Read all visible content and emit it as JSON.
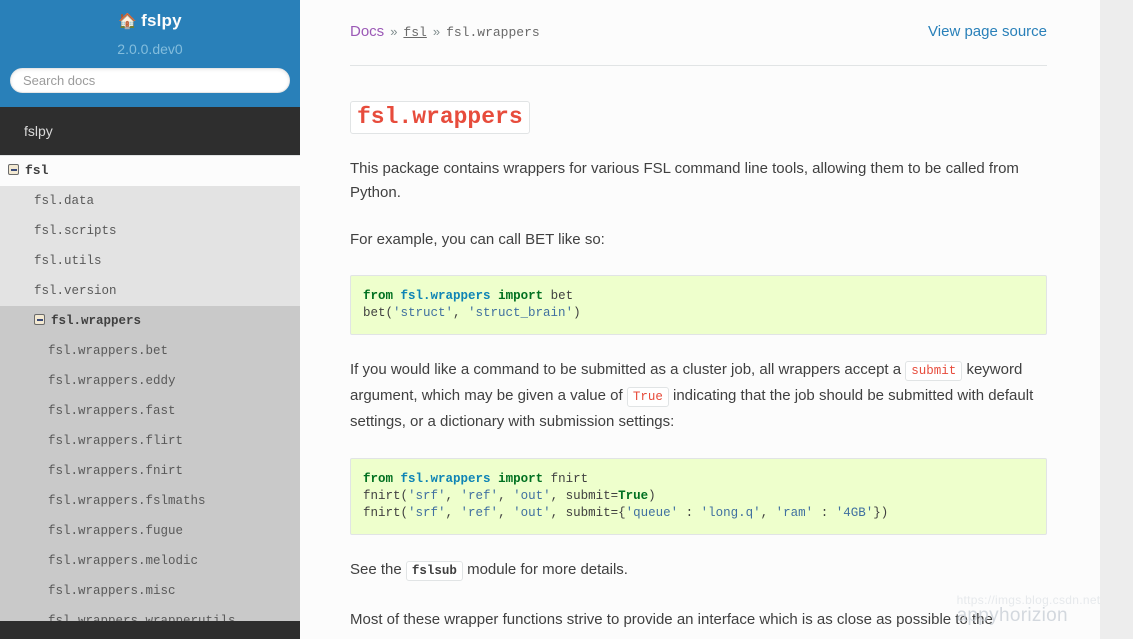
{
  "sidebar": {
    "brand": "fslpy",
    "home_icon": "home-icon",
    "version": "2.0.0.dev0",
    "search_placeholder": "Search docs",
    "search_value": "",
    "nav_title": "fslpy",
    "nav": [
      {
        "label": "fsl",
        "expander": "collapse-icon",
        "current": false,
        "children": [
          {
            "label": "fsl.data"
          },
          {
            "label": "fsl.scripts"
          },
          {
            "label": "fsl.utils"
          },
          {
            "label": "fsl.version"
          },
          {
            "label": "fsl.wrappers",
            "expander": "collapse-icon",
            "current": true,
            "children": [
              {
                "label": "fsl.wrappers.bet"
              },
              {
                "label": "fsl.wrappers.eddy"
              },
              {
                "label": "fsl.wrappers.fast"
              },
              {
                "label": "fsl.wrappers.flirt"
              },
              {
                "label": "fsl.wrappers.fnirt"
              },
              {
                "label": "fsl.wrappers.fslmaths"
              },
              {
                "label": "fsl.wrappers.fugue"
              },
              {
                "label": "fsl.wrappers.melodic"
              },
              {
                "label": "fsl.wrappers.misc"
              },
              {
                "label": "fsl.wrappers.wrapperutils"
              }
            ]
          }
        ]
      }
    ]
  },
  "breadcrumb": {
    "docs": "Docs",
    "sep1": "»",
    "crumb1": "fsl",
    "sep2": "»",
    "crumb2": "fsl.wrappers",
    "view_source": "View page source"
  },
  "content": {
    "title": "fsl.wrappers",
    "para1": "This package contains wrappers for various FSL command line tools, allowing them to be called from Python.",
    "para2": "For example, you can call BET like so:",
    "code1": {
      "l1_kw_from": "from",
      "l1_module": "fsl.wrappers",
      "l1_kw_import": "import",
      "l1_name": "bet",
      "l2_fn": "bet(",
      "l2_s1": "'struct'",
      "l2_comma": ", ",
      "l2_s2": "'struct_brain'",
      "l2_close": ")"
    },
    "para3_a": "If you would like a command to be submitted as a cluster job, all wrappers accept a ",
    "para3_code1": "submit",
    "para3_b": " keyword argument, which may be given a value of ",
    "para3_code2": "True",
    "para3_c": " indicating that the job should be submitted with default settings, or a dictionary with submission settings:",
    "code2": {
      "l1_kw_from": "from",
      "l1_module": "fsl.wrappers",
      "l1_kw_import": "import",
      "l1_name": "fnirt",
      "l2": "fnirt('srf', 'ref', 'out', submit=True)",
      "l2_fn": "fnirt(",
      "l2_s1": "'srf'",
      "l2_s2": "'ref'",
      "l2_s3": "'out'",
      "l2_kwarg": ", submit=",
      "l2_true": "True",
      "l2_close": ")",
      "l3_fn": "fnirt(",
      "l3_s1": "'srf'",
      "l3_s2": "'ref'",
      "l3_s3": "'out'",
      "l3_kwarg": ", submit={",
      "l3_k1": "'queue'",
      "l3_colon": " : ",
      "l3_v1": "'long.q'",
      "l3_comma": ", ",
      "l3_k2": "'ram'",
      "l3_v2": "'4GB'",
      "l3_close": "})"
    },
    "para4_a": "See the ",
    "para4_code": "fslsub",
    "para4_b": " module for more details.",
    "para5": "Most of these wrapper functions strive to provide an interface which is as close as possible to the"
  },
  "watermark": {
    "url": "https://imgs.blog.csdn.net/hap",
    "text": "appyhorizion"
  },
  "colors": {
    "sidebar_blue": "#2980b9",
    "nav_title_dark": "#2e2e2e",
    "accent_link": "#2980b9",
    "visited_link": "#9b59b6",
    "code_literal_red": "#e74c3c",
    "code_block_bg": "#eeffcc",
    "content_bg": "#fcfcfc",
    "page_bg": "#ededed"
  }
}
